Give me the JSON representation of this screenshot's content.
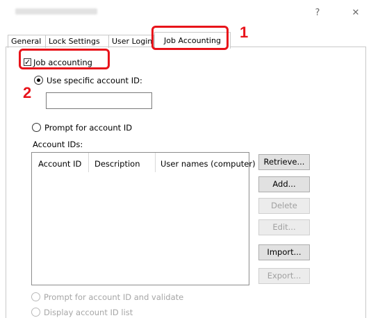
{
  "window": {
    "title": "Administrator Settings",
    "help_glyph": "?",
    "close_glyph": "✕"
  },
  "tabs": [
    {
      "label": "General"
    },
    {
      "label": "Lock Settings"
    },
    {
      "label": "User Login"
    },
    {
      "label": "Job Accounting",
      "active": true
    }
  ],
  "callouts": {
    "step1": "1",
    "step2": "2"
  },
  "job_accounting_checkbox": {
    "label": "Job accounting",
    "checked": true
  },
  "use_specific_radio": {
    "label": "Use specific account ID:",
    "selected": true
  },
  "specific_id_input": {
    "value": ""
  },
  "prompt_radio": {
    "label": "Prompt for account ID"
  },
  "account_ids": {
    "label": "Account IDs:",
    "columns": [
      "Account ID",
      "Description",
      "User names (computer)"
    ],
    "rows": []
  },
  "buttons": {
    "retrieve": "Retrieve...",
    "add": "Add...",
    "delete": "Delete",
    "edit": "Edit...",
    "import": "Import...",
    "export": "Export..."
  },
  "prompt_validate_radio": {
    "label": "Prompt for account ID and validate",
    "disabled": true
  },
  "display_list_radio": {
    "label": "Display account ID list",
    "disabled": true
  },
  "colors": {
    "callout": "#e8131a",
    "disabled_text": "#a6a6a6"
  }
}
